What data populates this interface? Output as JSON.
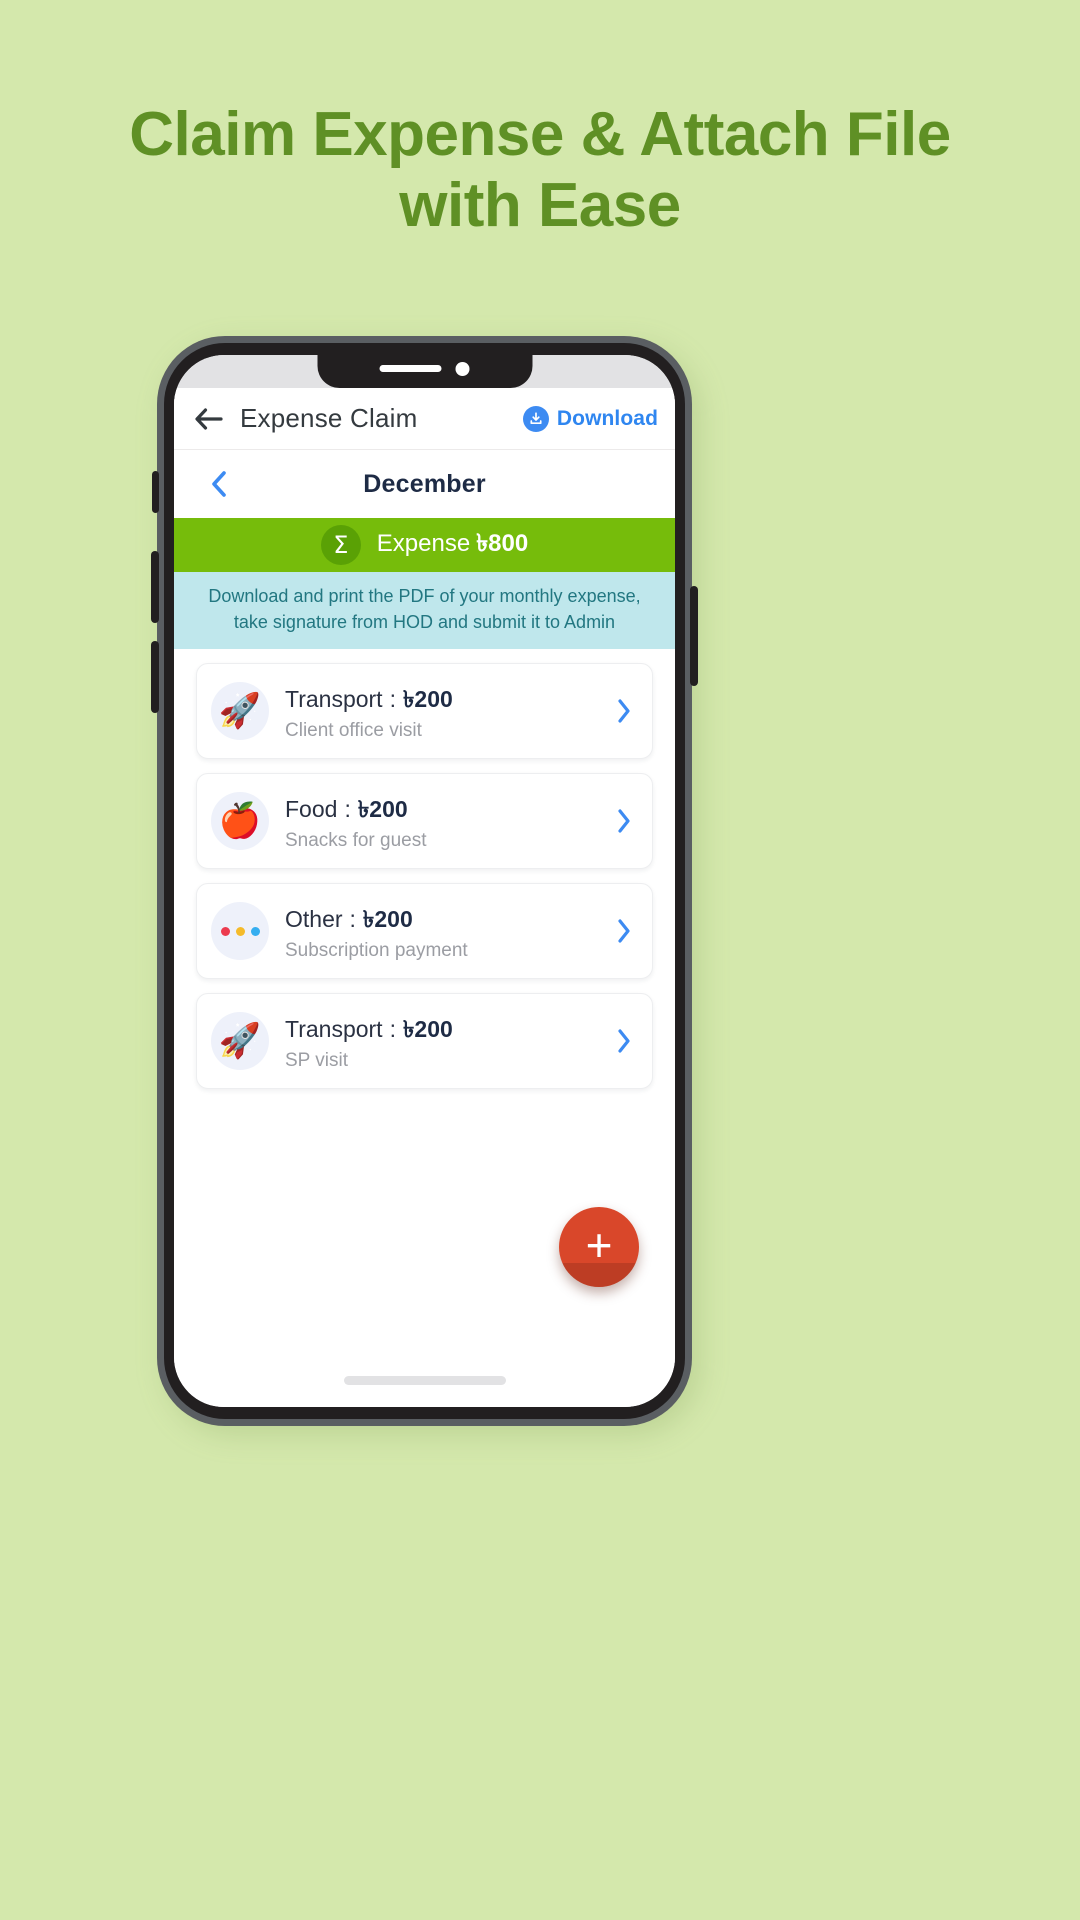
{
  "headline": {
    "line1": "Claim Expense & Attach File",
    "line2": "with Ease",
    "color": "#5f9025"
  },
  "background_color": "#d4e8ac",
  "app": {
    "header": {
      "back_icon": "back-arrow-icon",
      "title": "Expense Claim",
      "download_icon": "download-icon",
      "download_label": "Download",
      "accent_color": "#2f86f0"
    },
    "month_bar": {
      "prev_icon": "chevron-left-icon",
      "month": "December"
    },
    "total_banner": {
      "sigma_icon": "sigma-icon",
      "sigma_glyph": "Σ",
      "label": "Expense",
      "amount": "৳800",
      "background_color": "#76bc0b"
    },
    "info_banner": {
      "text": "Download and print the PDF of your monthly expense, take signature from HOD and submit it to Admin",
      "background_color": "#bfe7ec",
      "text_color": "#227781"
    },
    "expenses": [
      {
        "icon": "rocket-icon",
        "emoji": "🚀",
        "category": "Transport",
        "separator": ":",
        "amount": "৳200",
        "description": "Client office visit",
        "chevron": "chevron-right-icon"
      },
      {
        "icon": "apple-icon",
        "emoji": "🍎",
        "category": "Food",
        "separator": ":",
        "amount": "৳200",
        "description": "Snacks for guest",
        "chevron": "chevron-right-icon"
      },
      {
        "icon": "three-dots-icon",
        "emoji": "",
        "category": "Other",
        "separator": ":",
        "amount": "৳200",
        "description": "Subscription payment",
        "chevron": "chevron-right-icon"
      },
      {
        "icon": "rocket-icon",
        "emoji": "🚀",
        "category": "Transport",
        "separator": ":",
        "amount": "৳200",
        "description": "SP visit",
        "chevron": "chevron-right-icon"
      }
    ],
    "fab": {
      "icon": "plus-icon",
      "label": "+",
      "color": "#d9472a"
    }
  }
}
